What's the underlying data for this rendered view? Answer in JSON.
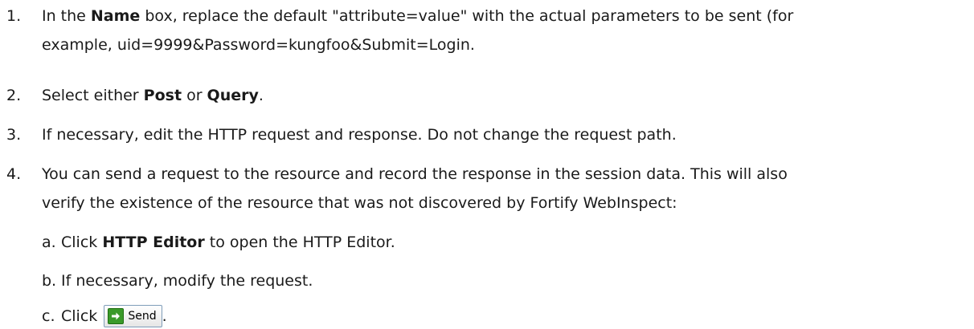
{
  "steps": [
    {
      "num": "1.",
      "line1_pre": "In the ",
      "line1_bold": "Name",
      "line1_post": " box, replace the default \"attribute=value\" with the actual parameters to be sent (for",
      "line2": "example, uid=9999&Password=kungfoo&Submit=Login."
    },
    {
      "num": "2.",
      "pre": "Select either ",
      "bold1": "Post",
      "mid": " or ",
      "bold2": "Query",
      "post": "."
    },
    {
      "num": "3.",
      "text": "If necessary, edit the HTTP request and response. Do not change the request path."
    },
    {
      "num": "4.",
      "line1": "You can send a request to the resource and record the response in the session data. This will also",
      "line2": "verify the existence of the resource that was not discovered by Fortify WebInspect:"
    }
  ],
  "substeps": [
    {
      "letter": "a.",
      "pre": "Click ",
      "bold": "HTTP Editor",
      "post": " to open the HTTP Editor."
    },
    {
      "letter": "b.",
      "text": "If necessary, modify the request."
    },
    {
      "letter": "c.",
      "pre": "Click ",
      "button_label": "Send",
      "post": "."
    }
  ],
  "icons": {
    "send_button_icon": "green-arrow-right-icon"
  }
}
